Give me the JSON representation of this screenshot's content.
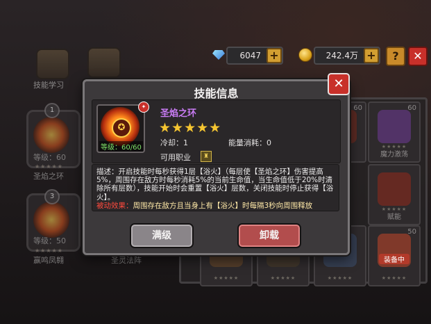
{
  "topbar": {
    "gems": "6047",
    "gold": "242.4万",
    "help_label": "?",
    "close_label": "✕"
  },
  "left": {
    "nav_skill_study": "技能学习",
    "slot1": {
      "level_badge": "1",
      "level_text": "等级：60",
      "name": "圣焰之环"
    },
    "slot3": {
      "level_badge": "3",
      "level_text": "等级：50",
      "name": "赢鸣凤翱"
    },
    "slot_holy": {
      "name": "圣灵法阵"
    }
  },
  "grid": {
    "cards": [
      {
        "num": "60",
        "label": "",
        "art_color": "#7a2c1e"
      },
      {
        "num": "60",
        "label": "魔力激荡",
        "art_color": "#6a3b8f"
      },
      {
        "num": "",
        "label": "",
        "art_color": "#4a3c2a"
      },
      {
        "num": "",
        "label": "赋能",
        "art_color": "#8a2a1c"
      },
      {
        "num": "50",
        "label": "",
        "art_color": "#7a2c1e"
      },
      {
        "num": "50",
        "label": "",
        "art_color": "#b8452a"
      }
    ],
    "equipped_tag": "装备中",
    "stars": "★★★★★"
  },
  "modal": {
    "title": "技能信息",
    "close": "✕",
    "skill_name": "圣焰之环",
    "stars": "★★★★★",
    "level": "等级：60/60",
    "cooldown": "冷却：1",
    "energy": "能量消耗：0",
    "job_label": "可用职业",
    "description": "描述：开启技能时每秒获得1层【浴火】（每层使【圣焰之环】伤害提高5%，周围存在敌方时每秒消耗5%的当前生命值，当生命值低于20%时清除所有层数），技能开始时会重置【浴火】层数，关闭技能时停止获得【浴火】。",
    "passive_tag": "被动效果：",
    "passive_text": "周围存在敌方且当身上有【浴火】时每隔3秒向周围释放",
    "btn_max": "满级",
    "btn_unload": "卸载"
  },
  "colors": {
    "accent_gold": "#f5c531",
    "skill_name_purple": "#c97cf5",
    "passive_red": "#ff4a3d",
    "close_red": "#c8302a"
  }
}
